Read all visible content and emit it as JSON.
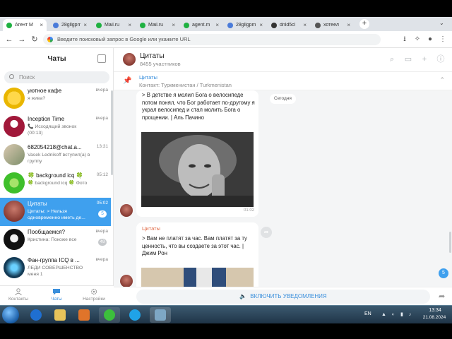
{
  "browser": {
    "tabs": [
      {
        "label": "Агент M",
        "icon": "icq-agent-icon",
        "color": "#1fb141",
        "active": true
      },
      {
        "label": "28gllgpm",
        "icon": "globe-icon",
        "color": "#4a7bd9",
        "active": false
      },
      {
        "label": "Mail.ru",
        "icon": "mailru-icon",
        "color": "#1fb141",
        "active": false
      },
      {
        "label": "Mail.ru",
        "icon": "mailru-icon",
        "color": "#1fb141",
        "active": false
      },
      {
        "label": "agent.m",
        "icon": "icq-agent-icon",
        "color": "#1fb141",
        "active": false
      },
      {
        "label": "28gllgpm",
        "icon": "globe-icon",
        "color": "#4a7bd9",
        "active": false
      },
      {
        "label": "dnld5cl",
        "icon": "download-site-icon",
        "color": "#333333",
        "active": false
      },
      {
        "label": "хотеел",
        "icon": "hotel-site-icon",
        "color": "#555555",
        "active": false
      }
    ],
    "address_placeholder": "Введите поисковый запрос в Google или укажите URL"
  },
  "sidebar": {
    "title": "Чаты",
    "search_placeholder": "Поиск",
    "chats": [
      {
        "name": "уютное кафе",
        "time": "вчера",
        "preview": "я жива?",
        "badge": "",
        "avatar": "cafe-avatar",
        "active": false
      },
      {
        "name": "Inception Time",
        "time": "вчера",
        "preview": "📞 Исходящий звонок (00:13)",
        "badge": "",
        "avatar": "inception-avatar",
        "active": false
      },
      {
        "name": "682054218@chat.a...",
        "time": "13:31",
        "preview": "Vasek Lednikoff вступил(а) в группу",
        "badge": "",
        "avatar": "group-avatar",
        "active": false
      },
      {
        "name": "🍀 background icq 🍀",
        "time": "05:12",
        "preview": "🍀 background icq 🍀 Фото",
        "badge": "",
        "avatar": "icq-avatar",
        "active": false
      },
      {
        "name": "Цитаты",
        "time": "05:02",
        "preview": "Цитаты: > Нельзя одновременно иметь де...",
        "badge": "5",
        "avatar": "quotes-avatar",
        "active": true
      },
      {
        "name": "Пообщаемся?",
        "time": "вчера",
        "preview": "Кристина: Покоже все",
        "badge": "49",
        "avatar": "chat-avatar",
        "active": false
      },
      {
        "name": "Фан-группа ICQ в ...",
        "time": "вчера",
        "preview": "ЛЕДИ СОВЕРШЕНСТВО меня 1",
        "badge": "",
        "avatar": "fan-group-avatar",
        "active": false
      }
    ],
    "nav": [
      {
        "label": "Контакты",
        "icon": "contacts-icon",
        "active": false
      },
      {
        "label": "Чаты",
        "icon": "chats-icon",
        "active": true
      },
      {
        "label": "Настройки",
        "icon": "settings-icon",
        "active": false
      }
    ]
  },
  "chat": {
    "name": "Цитаты",
    "members": "8455 участников",
    "pinned_title": "Цитаты",
    "pinned_text": "Контакт: Туркменистан / Turkmenistan",
    "date_label": "Сегодня",
    "messages": [
      {
        "text": "> В детстве я молил Бога о велосипеде потом понял, что Бог работает по-другому я украл велосипед и стал молить Бога о прощении. | Аль Пачино",
        "time": "01:02",
        "has_photo": true
      },
      {
        "author": "Цитаты",
        "text": "> Вам не платят за час. Вам платят за ту ценность, что вы создаете за этот час. | Джим Рон",
        "has_photo": true
      }
    ],
    "scroll_badge": "5",
    "notify_label": "ВКЛЮЧИТЬ УВЕДОМЛЕНИЯ"
  },
  "taskbar": {
    "lang": "EN",
    "time": "13:34",
    "date": "21.08.2024",
    "apps": [
      "internet-explorer-icon",
      "file-explorer-icon",
      "media-player-icon",
      "icq-agent-icon",
      "skype-icon",
      "agent-window-icon"
    ]
  },
  "colors": {
    "accent": "#3fa0ee",
    "author": "#e06d4a",
    "taskbar": "#2a4560"
  }
}
